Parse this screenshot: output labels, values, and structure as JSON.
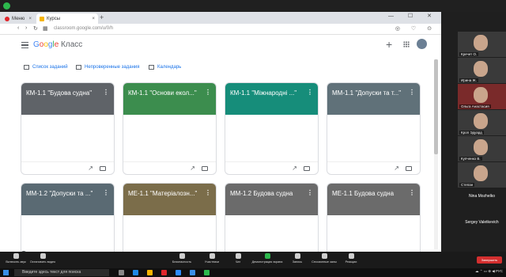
{
  "browser": {
    "tabs": [
      {
        "label": "Меню",
        "icon": "opera-icon"
      },
      {
        "label": "Курсы",
        "icon": "classroom-icon"
      }
    ],
    "url": "classroom.google.com/u/0/h"
  },
  "header": {
    "app_name_google": "Google",
    "app_name_suffix": " Класс"
  },
  "subnav": {
    "tasks": "Список заданий",
    "unchecked": "Непроверенные задания",
    "calendar": "Календарь"
  },
  "courses": [
    {
      "title": "КМ-1.1 \"Будова судна\"",
      "color": "#5f6368"
    },
    {
      "title": "КМ-1.1 \"Основи екол...\"",
      "color": "#3c8d4e"
    },
    {
      "title": "КМ-1.1 \"Міжнародні ...\"",
      "color": "#168d7a"
    },
    {
      "title": "ММ-1.1 \"Допуски та т...\"",
      "color": "#607179"
    },
    {
      "title": "ММ-1.2 \"Допуски та ...\"",
      "color": "#5a6a73"
    },
    {
      "title": "МЕ-1.1 \"Матеріалозн...\"",
      "color": "#7b6d4a"
    },
    {
      "title": "ММ-1.2 Будова судна",
      "color": "#6b6b6b"
    },
    {
      "title": "МЕ-1.1 Будова судна",
      "color": "#6b6b6b"
    }
  ],
  "participants": [
    {
      "name": "Кречет О."
    },
    {
      "name": "Ирина Ж."
    },
    {
      "name": "Ольга Анастасия"
    },
    {
      "name": "Кроп Эдуард"
    },
    {
      "name": "Купченко В."
    },
    {
      "name": "Степан"
    }
  ],
  "participant_names": [
    "Nina Mozhelko",
    "Sergey Valetkevich"
  ],
  "controls": [
    "Включить звук",
    "Остановить видео",
    "Безопасность",
    "Участники",
    "Чат",
    "Демонстрация экрана",
    "Запись",
    "Сессионные залы",
    "Реакции"
  ],
  "leave_label": "Завершить",
  "taskbar": {
    "search_placeholder": "Введите здесь текст для поиска"
  },
  "colors": {
    "accent": "#1a73e8",
    "leave": "#d32f2f"
  }
}
